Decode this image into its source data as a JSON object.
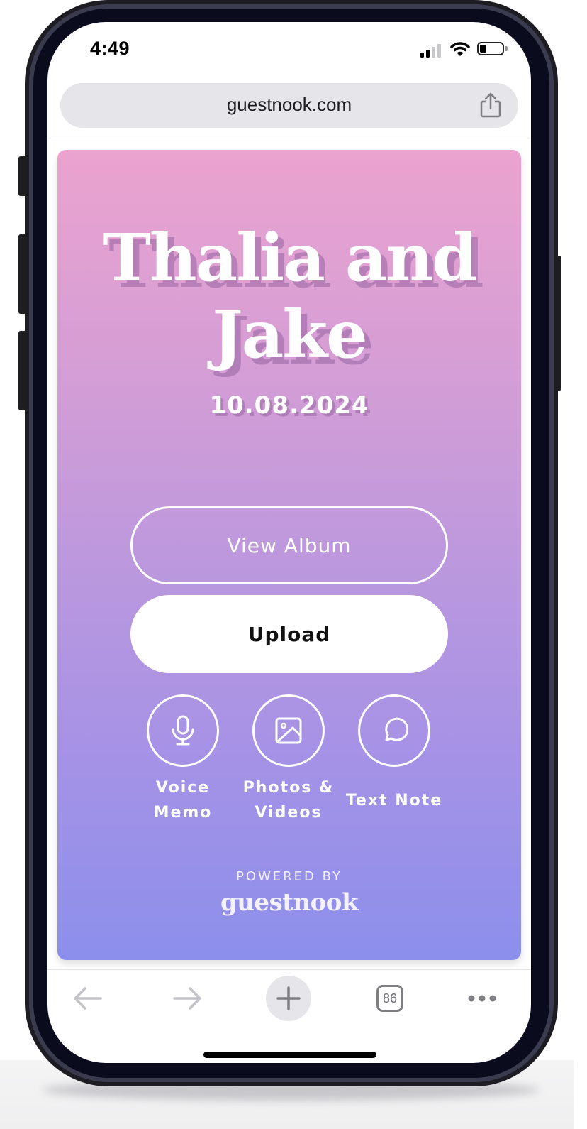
{
  "status_bar": {
    "time": "4:49",
    "icons": [
      "cellular-signal-icon",
      "wifi-icon",
      "battery-icon"
    ]
  },
  "browser": {
    "url": "guestnook.com",
    "share_icon": "share-icon",
    "toolbar": {
      "back_icon": "arrow-left-icon",
      "forward_icon": "arrow-right-icon",
      "new_tab_icon": "plus-icon",
      "tab_count": "86",
      "more_icon": "ellipsis-icon"
    }
  },
  "page": {
    "title": "Thalia and Jake",
    "title_line1": "Thalia and",
    "title_line2": "Jake",
    "date": "10.08.2024",
    "buttons": {
      "view_album": "View Album",
      "upload": "Upload"
    },
    "actions": [
      {
        "icon": "microphone-icon",
        "label_line1": "Voice",
        "label_line2": "Memo"
      },
      {
        "icon": "image-icon",
        "label_line1": "Photos &",
        "label_line2": "Videos"
      },
      {
        "icon": "chat-bubble-icon",
        "label_line1": "Text Note",
        "label_line2": ""
      }
    ],
    "footer": {
      "powered_by": "POWERED BY",
      "brand": "guestnook"
    },
    "colors": {
      "gradient_top": "#eba3cf",
      "gradient_bottom": "#8c8fec"
    }
  }
}
